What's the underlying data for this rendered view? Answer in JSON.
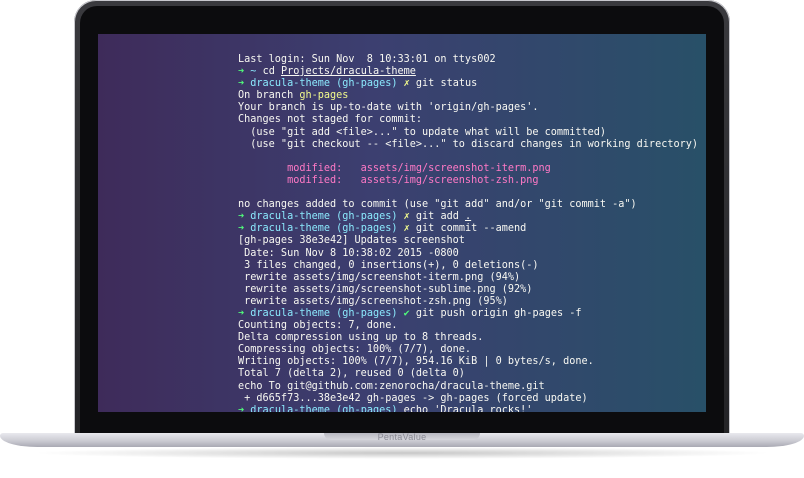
{
  "brand": "PentaValue",
  "terminal": {
    "lines": [
      [
        {
          "t": "Last login: Sun Nov  8 10:33:01 on ttys002",
          "c": ""
        }
      ],
      [
        {
          "t": "➜ ",
          "c": "green"
        },
        {
          "t": "~ ",
          "c": "cyan"
        },
        {
          "t": "cd ",
          "c": ""
        },
        {
          "t": "Projects/dracula-theme",
          "c": "u"
        }
      ],
      [
        {
          "t": "➜ ",
          "c": "green"
        },
        {
          "t": "dracula-theme ",
          "c": "cyan"
        },
        {
          "t": "(gh-pages) ",
          "c": "cyan"
        },
        {
          "t": "✗ ",
          "c": "yellow"
        },
        {
          "t": "git status",
          "c": ""
        }
      ],
      [
        {
          "t": "On branch ",
          "c": ""
        },
        {
          "t": "gh-pages",
          "c": "yellow"
        }
      ],
      [
        {
          "t": "Your branch is up-to-date with 'origin/gh-pages'.",
          "c": ""
        }
      ],
      [
        {
          "t": "Changes not staged for commit:",
          "c": ""
        }
      ],
      [
        {
          "t": "  (use \"git add <file>...\" to update what will be committed)",
          "c": ""
        }
      ],
      [
        {
          "t": "  (use \"git checkout -- <file>...\" to discard changes in working directory)",
          "c": ""
        }
      ],
      [
        {
          "t": "",
          "c": ""
        }
      ],
      [
        {
          "t": "        modified:   assets/img/screenshot-iterm.png",
          "c": "pink"
        }
      ],
      [
        {
          "t": "        modified:   assets/img/screenshot-zsh.png",
          "c": "pink"
        }
      ],
      [
        {
          "t": "",
          "c": ""
        }
      ],
      [
        {
          "t": "no changes added to commit (use \"git add\" and/or \"git commit -a\")",
          "c": ""
        }
      ],
      [
        {
          "t": "➜ ",
          "c": "green"
        },
        {
          "t": "dracula-theme ",
          "c": "cyan"
        },
        {
          "t": "(gh-pages) ",
          "c": "cyan"
        },
        {
          "t": "✗ ",
          "c": "yellow"
        },
        {
          "t": "git add ",
          "c": ""
        },
        {
          "t": ".",
          "c": "u"
        }
      ],
      [
        {
          "t": "➜ ",
          "c": "green"
        },
        {
          "t": "dracula-theme ",
          "c": "cyan"
        },
        {
          "t": "(gh-pages) ",
          "c": "cyan"
        },
        {
          "t": "✗ ",
          "c": "yellow"
        },
        {
          "t": "git commit --amend",
          "c": ""
        }
      ],
      [
        {
          "t": "[gh-pages 38e3e42] Updates screenshot",
          "c": ""
        }
      ],
      [
        {
          "t": " Date: Sun Nov 8 10:38:02 2015 -0800",
          "c": ""
        }
      ],
      [
        {
          "t": " 3 files changed, 0 insertions(+), 0 deletions(-)",
          "c": ""
        }
      ],
      [
        {
          "t": " rewrite assets/img/screenshot-iterm.png (94%)",
          "c": ""
        }
      ],
      [
        {
          "t": " rewrite assets/img/screenshot-sublime.png (92%)",
          "c": ""
        }
      ],
      [
        {
          "t": " rewrite assets/img/screenshot-zsh.png (95%)",
          "c": ""
        }
      ],
      [
        {
          "t": "➜ ",
          "c": "green"
        },
        {
          "t": "dracula-theme ",
          "c": "cyan"
        },
        {
          "t": "(gh-pages) ",
          "c": "cyan"
        },
        {
          "t": "✔ ",
          "c": "green"
        },
        {
          "t": "git push origin gh-pages -f",
          "c": ""
        }
      ],
      [
        {
          "t": "Counting objects: 7, done.",
          "c": ""
        }
      ],
      [
        {
          "t": "Delta compression using up to 8 threads.",
          "c": ""
        }
      ],
      [
        {
          "t": "Compressing objects: 100% (7/7), done.",
          "c": ""
        }
      ],
      [
        {
          "t": "Writing objects: 100% (7/7), 954.16 KiB | 0 bytes/s, done.",
          "c": ""
        }
      ],
      [
        {
          "t": "Total 7 (delta 2), reused 0 (delta 0)",
          "c": ""
        }
      ],
      [
        {
          "t": "echo To git@github.com:zenorocha/dracula-theme.git",
          "c": ""
        }
      ],
      [
        {
          "t": " + d665f73...38e3e42 gh-pages -> gh-pages (forced update)",
          "c": ""
        }
      ],
      [
        {
          "t": "➜ ",
          "c": "green"
        },
        {
          "t": "dracula-theme ",
          "c": "cyan"
        },
        {
          "t": "(gh-pages) ",
          "c": "cyan"
        },
        {
          "t": "echo 'Dracula rocks!'",
          "c": ""
        }
      ]
    ]
  },
  "colors": {
    "green": "#50fa7b",
    "cyan": "#8be9fd",
    "pink": "#ff79c6",
    "yellow": "#f1fa8c",
    "foreground": "#f8f8f2"
  }
}
